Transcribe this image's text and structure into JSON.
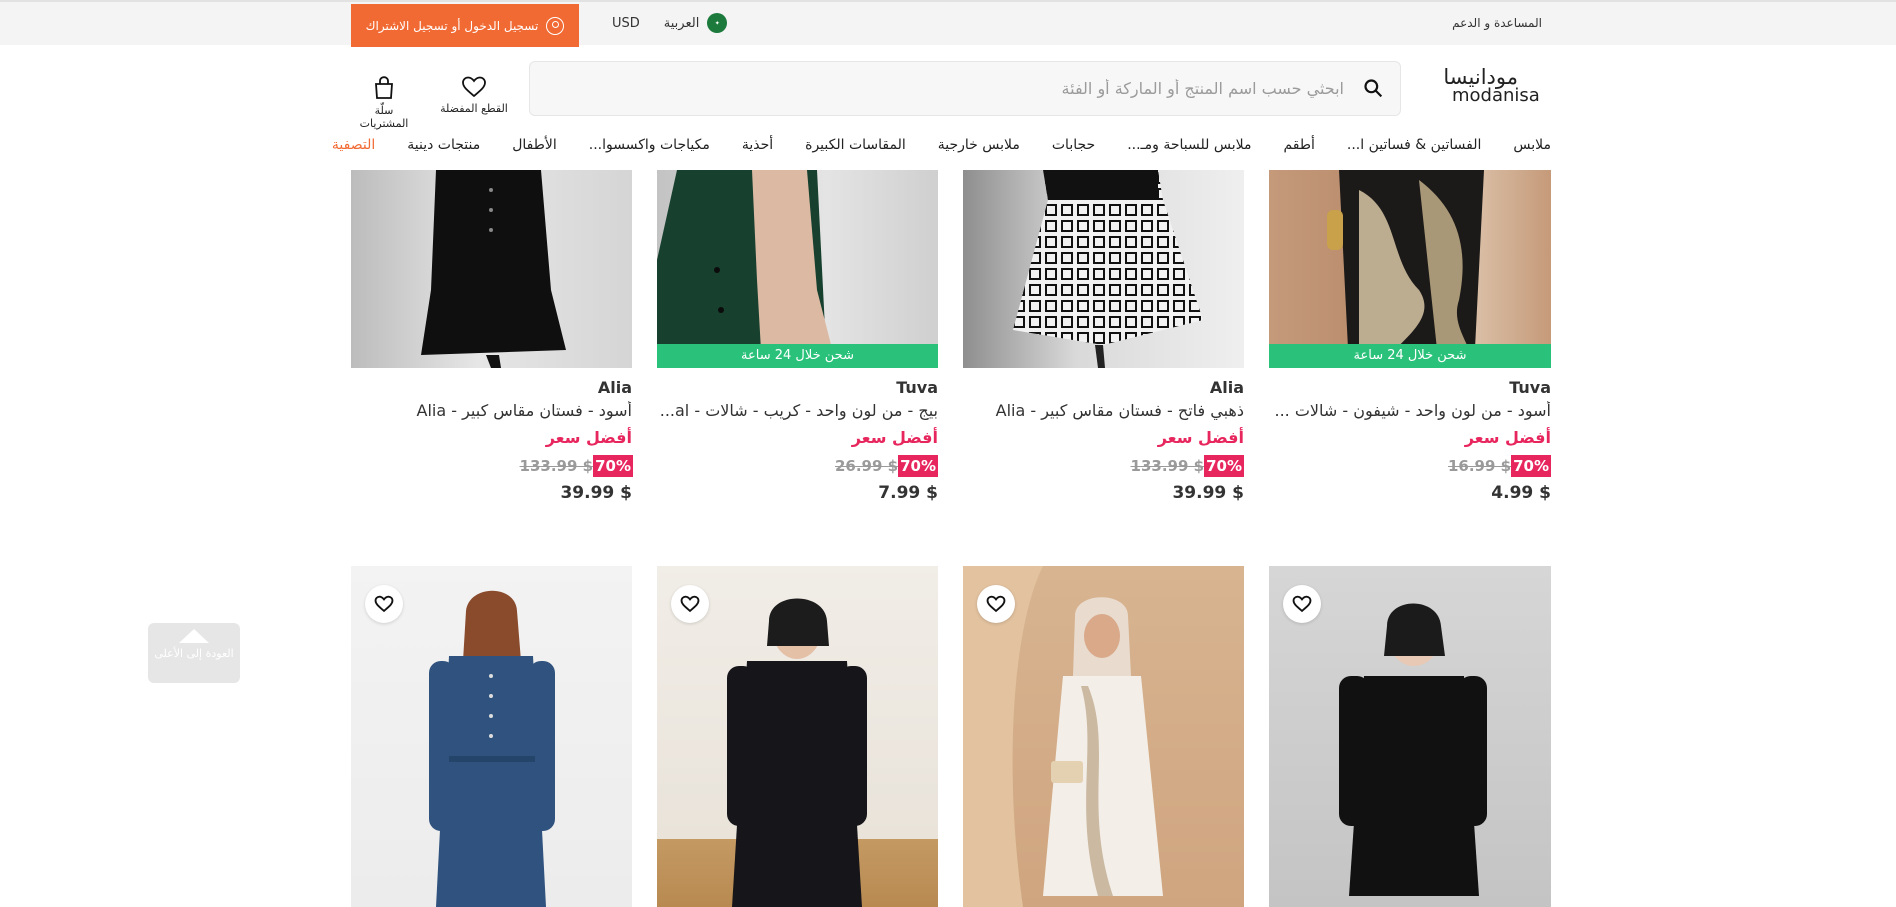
{
  "topbar": {
    "help_label": "المساعدة و الدعم",
    "flag_icon": "saudi-flag-icon",
    "language_label": "العربية",
    "currency_label": "USD",
    "login_label": "تسجيل الدخول أو تسجيل الاشتراك",
    "login_bg": "#f26a33"
  },
  "header": {
    "logo_ar": "مودانيسا",
    "logo_en": "modanisa",
    "search_placeholder": "ابحثي حسب اسم المنتج أو الماركة أو الفئة",
    "favorites_label": "القطع المفضلة",
    "cart_label": "سلّة المشتريات"
  },
  "categories": [
    "ملابس",
    "الفساتين & فساتين ا...",
    "أطقم",
    "ملابس للسباحة ومـ...",
    "حجابات",
    "ملابس خارجية",
    "المقاسات الكبيرة",
    "أحذية",
    "مكياجات واكسسوا...",
    "الأطفال",
    "منتجات دينية",
    "التصفية"
  ],
  "products_row1": [
    {
      "brand": "Tuva",
      "name": "أسود - من لون واحد - شيفون - شالات ...",
      "best_price_label": "أفضل سعر",
      "discount": "70%",
      "old_price": "16.99 $",
      "price": "4.99 $",
      "badge": "شحن خلال 24 ساعة"
    },
    {
      "brand": "Alia",
      "name": "ذهبي فاتح - فستان مقاس كبير - Alia",
      "best_price_label": "أفضل سعر",
      "discount": "70%",
      "old_price": "133.99 $",
      "price": "39.99 $",
      "badge": ""
    },
    {
      "brand": "Tuva",
      "name": "بيج - من لون واحد - كريب - شالات - al...",
      "best_price_label": "أفضل سعر",
      "discount": "70%",
      "old_price": "26.99 $",
      "price": "7.99 $",
      "badge": "شحن خلال 24 ساعة"
    },
    {
      "brand": "Alia",
      "name": "أسود - فستان مقاس كبير - Alia",
      "best_price_label": "أفضل سعر",
      "discount": "70%",
      "old_price": "133.99 $",
      "price": "39.99 $",
      "badge": ""
    }
  ],
  "back_to_top_label": "العودة إلى الأعلى",
  "colors": {
    "accent": "#f26a33",
    "sale": "#e8265e",
    "badge": "#2ac27a"
  }
}
